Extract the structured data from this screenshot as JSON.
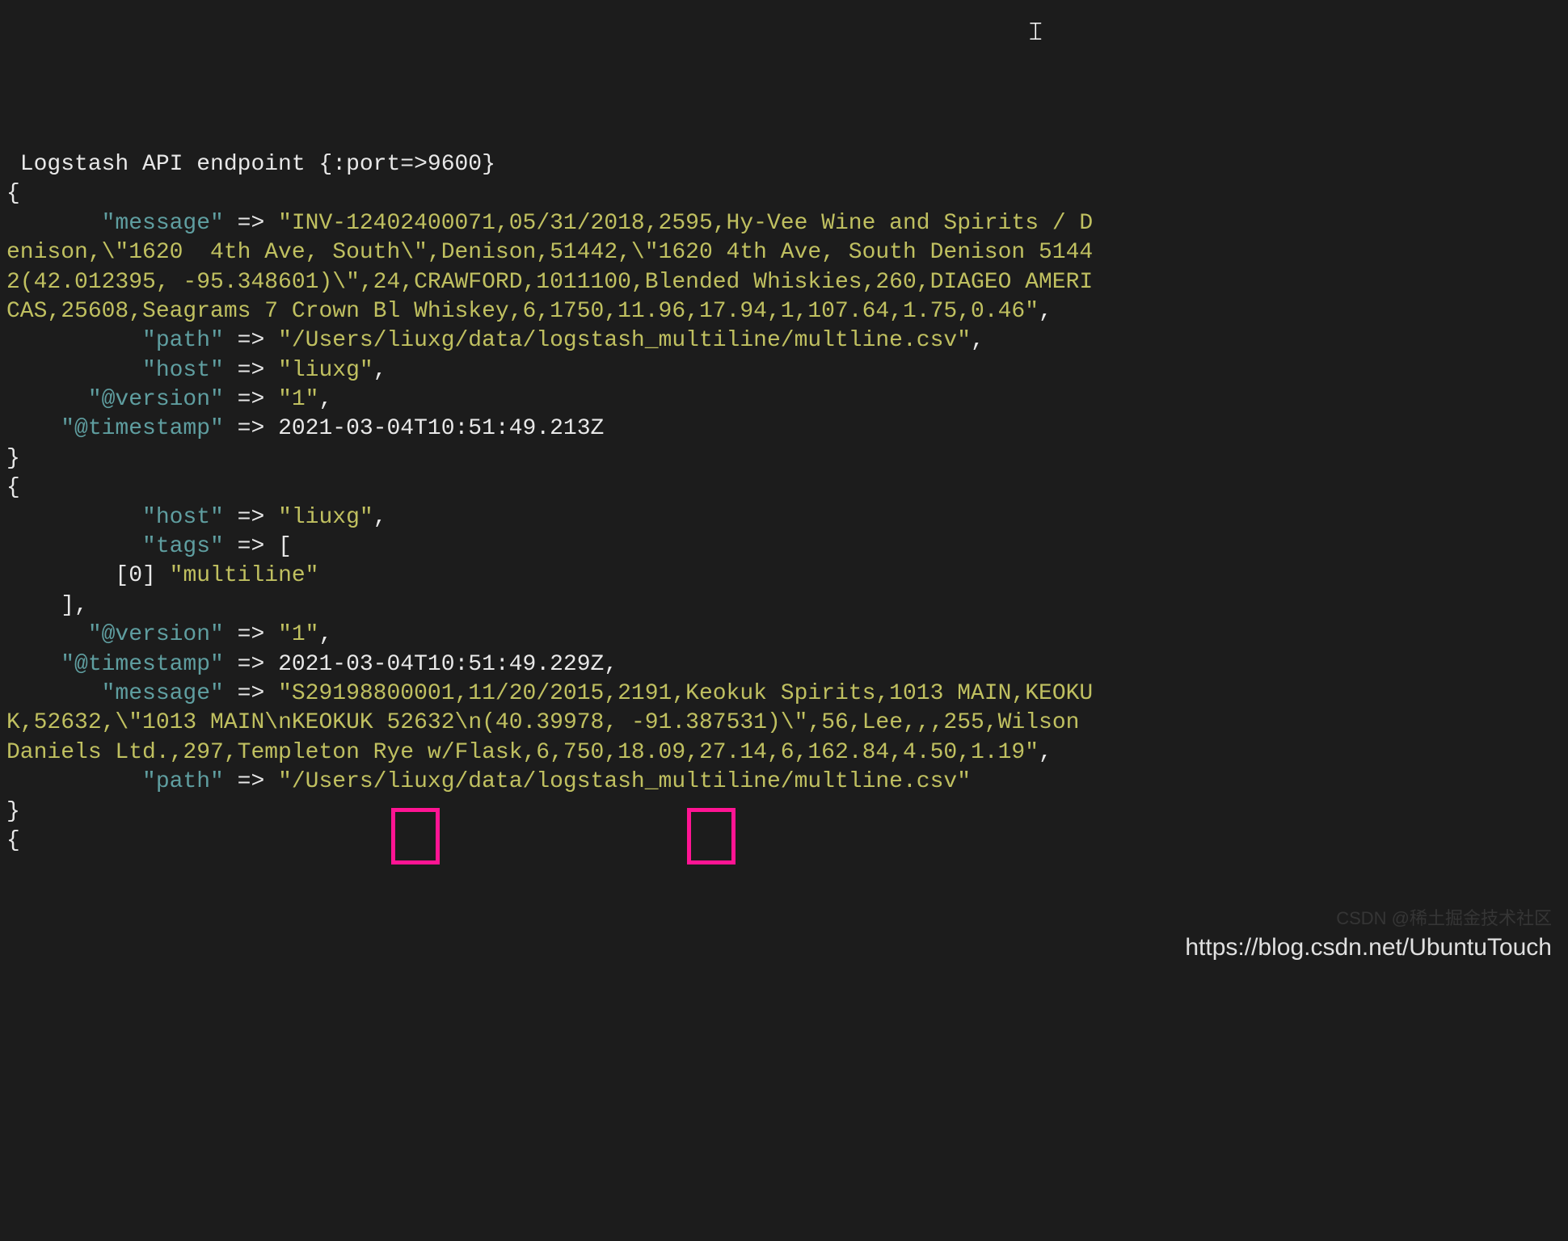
{
  "header_line": " Logstash API endpoint {:port=>9600}",
  "brace_open": "{",
  "brace_close": "}",
  "arrow": " => ",
  "comma": ",",
  "bracket_open": "[",
  "bracket_close": "    ],",
  "record1": {
    "message_key": "       \"message\"",
    "message_val_prefix": "\"INV-12402400071,05/31/2018,2595,Hy-Vee Wine and Spirits / D",
    "message_line2": "enison,\\\"1620  4th Ave, South\\\",Denison,51442,\\\"1620 4th Ave, South Denison 5144",
    "message_line3": "2(42.012395, -95.348601)\\\",24,CRAWFORD,1011100,Blended Whiskies,260,DIAGEO AMERI",
    "message_line4": "CAS,25608,Seagrams 7 Crown Bl Whiskey,6,1750,11.96,17.94,1,107.64,1.75,0.46\"",
    "path_key": "          \"path\"",
    "path_val": "\"/Users/liuxg/data/logstash_multiline/multline.csv\"",
    "host_key": "          \"host\"",
    "host_val": "\"liuxg\"",
    "version_key": "      \"@version\"",
    "version_val": "\"1\"",
    "timestamp_key": "    \"@timestamp\"",
    "timestamp_val": "2021-03-04T10:51:49.213Z"
  },
  "record2": {
    "host_key": "          \"host\"",
    "host_val": "\"liuxg\"",
    "tags_key": "          \"tags\"",
    "tags_idx": "        [0] ",
    "tags_val": "\"multiline\"",
    "version_key": "      \"@version\"",
    "version_val": "\"1\"",
    "timestamp_key": "    \"@timestamp\"",
    "timestamp_val": "2021-03-04T10:51:49.229Z",
    "message_key": "       \"message\"",
    "message_line1": "\"S29198800001,11/20/2015,2191,Keokuk Spirits,1013 MAIN,KEOKU",
    "message_line2a": "K,52632,\\\"1013 MAIN",
    "message_line2_hl1": "\\n",
    "message_line2b": "KEOKUK 52632",
    "message_line2_hl2": "\\n",
    "message_line2c": "(40.39978, -91.387531)\\\",56,Lee,,,255,Wilson ",
    "message_line3": "Daniels Ltd.,297,Templeton Rye w/Flask,6,750,18.09,27.14,6,162.84,4.50,1.19\"",
    "path_key": "          \"path\"",
    "path_val": "\"/Users/liuxg/data/logstash_multiline/multline.csv\""
  },
  "watermark": "https://blog.csdn.net/UbuntuTouch",
  "watermark_faint": "CSDN @稀土掘金技术社区",
  "cursor_char": "I"
}
